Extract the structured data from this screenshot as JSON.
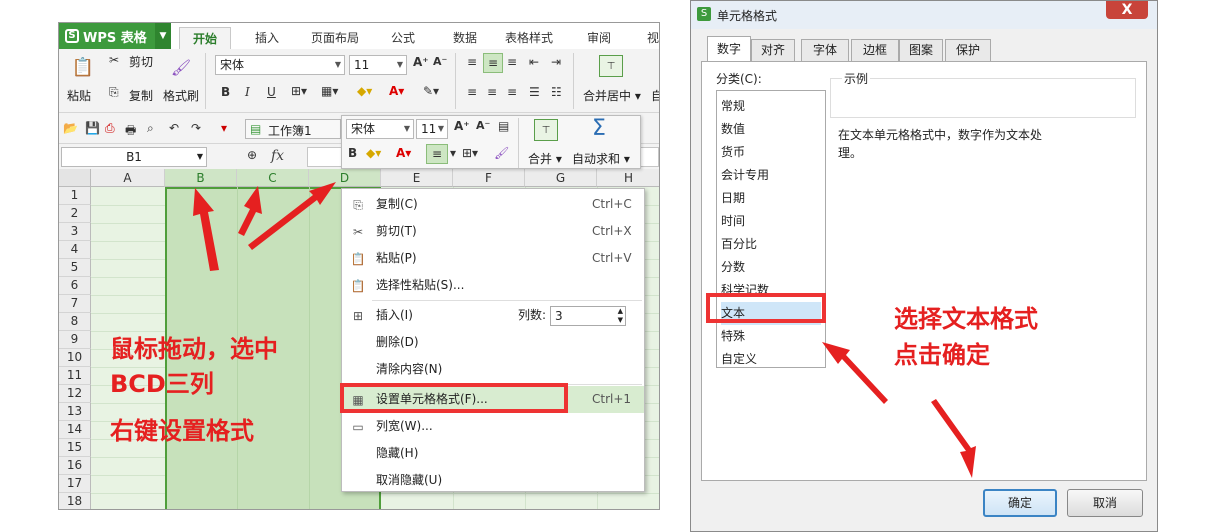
{
  "app": {
    "logo": "WPS 表格",
    "tabs": [
      "开始",
      "插入",
      "页面布局",
      "公式",
      "数据",
      "表格样式",
      "审阅",
      "视"
    ]
  },
  "ribbon": {
    "paste": "粘贴",
    "cut": "剪切",
    "copy": "复制",
    "format_painter": "格式刷",
    "font": "宋体",
    "size": "11",
    "merge": "合并居中",
    "auto": "自"
  },
  "qat": {
    "workbook": "工作簿1"
  },
  "formula": {
    "namebox": "B1",
    "fx": "fx"
  },
  "mini": {
    "font": "宋体",
    "size": "11",
    "merge": "合并",
    "autosum": "自动求和"
  },
  "grid": {
    "columns": [
      "A",
      "B",
      "C",
      "D",
      "E",
      "F",
      "G",
      "H"
    ],
    "rows": [
      "1",
      "2",
      "3",
      "4",
      "5",
      "6",
      "7",
      "8",
      "9",
      "10",
      "11",
      "12",
      "13",
      "14",
      "15",
      "16",
      "17",
      "18"
    ]
  },
  "context_menu": {
    "copy": "复制(C)",
    "copy_sc": "Ctrl+C",
    "cut": "剪切(T)",
    "cut_sc": "Ctrl+X",
    "paste": "粘贴(P)",
    "paste_sc": "Ctrl+V",
    "paste_special": "选择性粘贴(S)...",
    "insert": "插入(I)",
    "cols_label": "列数:",
    "cols_value": "3",
    "delete": "删除(D)",
    "clear": "清除内容(N)",
    "format_cells": "设置单元格格式(F)...",
    "format_sc": "Ctrl+1",
    "col_width": "列宽(W)...",
    "hide": "隐藏(H)",
    "unhide": "取消隐藏(U)"
  },
  "annotations": {
    "left_line1": "鼠标拖动，选中",
    "left_line2": "BCD三列",
    "left_line3": "右键设置格式",
    "right_line1": "选择文本格式",
    "right_line2": "点击确定"
  },
  "dialog": {
    "title": "单元格格式",
    "close": "X",
    "tabs": [
      "数字",
      "对齐",
      "字体",
      "边框",
      "图案",
      "保护"
    ],
    "category_label": "分类(C):",
    "categories": [
      "常规",
      "数值",
      "货币",
      "会计专用",
      "日期",
      "时间",
      "百分比",
      "分数",
      "科学记数",
      "文本",
      "特殊",
      "自定义"
    ],
    "sample_label": "示例",
    "description_line1": "在文本单元格格式中，数字作为文本处",
    "description_line2": "理。",
    "ok": "确定",
    "cancel": "取消"
  },
  "colors": {
    "wps_green": "#3d9a3d",
    "highlight_red": "#e33333",
    "selection": "#c7e1bb"
  }
}
